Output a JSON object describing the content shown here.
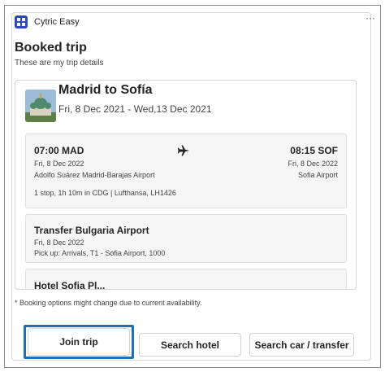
{
  "app": {
    "name": "Cytric Easy",
    "more_label": "···"
  },
  "card": {
    "heading": "Booked trip",
    "subheading": "These are my trip details"
  },
  "trip": {
    "title": "Madrid to Sofía",
    "dates": "Fri, 8 Dec 2021 - Wed,13 Dec 2021",
    "flight": {
      "dep_time": "07:00 MAD",
      "dep_date": "Fri, 8 Dec 2022",
      "dep_airport": "Adolfo Suárez Madrid-Barajas Airport",
      "arr_time": "08:15 SOF",
      "arr_date": "Fri, 8 Dec 2022",
      "arr_airport": "Sofia Airport",
      "stops": "1 stop, 1h 10m in CDG | Lufthansa, LH1426",
      "icon": "airplane-icon"
    },
    "transfer": {
      "title": "Transfer Bulgaria Airport",
      "date": "Fri, 8 Dec 2022",
      "pickup": "Pick up: Arrivals, T1 - Sofia Airport, 1000"
    },
    "hotel": {
      "title": "Hotel Sofia Pl..."
    }
  },
  "note": "* Booking options might change due to current availability.",
  "buttons": {
    "join": "Join trip",
    "hotel": "Search hotel",
    "car": "Search car / transfer"
  },
  "colors": {
    "brand": "#2b48c4",
    "highlight": "#1f6fb7"
  }
}
